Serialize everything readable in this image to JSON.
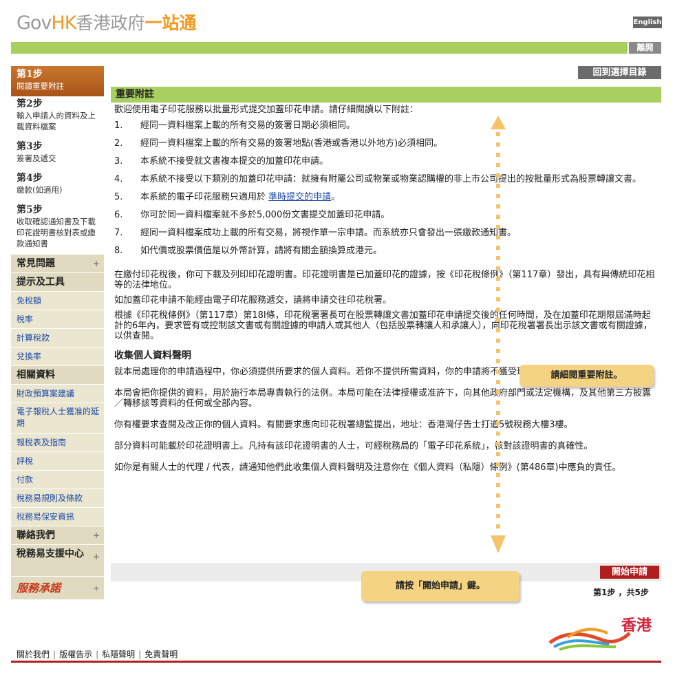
{
  "header": {
    "logo_gov": "Gov",
    "logo_hk": "HK",
    "logo_cn1": "香港政府",
    "logo_cn2": "一站通",
    "lang_button": "English",
    "leave_button": "離開"
  },
  "sidebar": {
    "steps": [
      {
        "title": "第1步",
        "desc": "閱讀重要附註"
      },
      {
        "title": "第2步",
        "desc": "輸入申請人的資料及上載資料檔案"
      },
      {
        "title": "第3步",
        "desc": "簽署及遞交"
      },
      {
        "title": "第4步",
        "desc": "繳款(如適用)"
      },
      {
        "title": "第5步",
        "desc": "收取確認通知書及下載印花證明書核對表或繳款通知書"
      }
    ],
    "faq": "常見問題",
    "tips": "提示及工具",
    "tips_items": [
      "免稅額",
      "稅率",
      "計算稅款",
      "兌換率"
    ],
    "related": "相關資料",
    "related_items": [
      "財政預算案建議",
      "電子報稅人士獲准的延期",
      "報稅表及指南",
      "評稅",
      "付款",
      "稅務易規則及條款",
      "稅務易保安資訊"
    ],
    "contact": "聯絡我們",
    "support": "稅務易支援中心",
    "signature": "服務承諾",
    "plus": "+"
  },
  "main": {
    "back_button": "回到選擇目錄",
    "section_title": "重要附註",
    "intro": "歡迎使用電子印花服務以批量形式提交加蓋印花申請。請仔細閱讀以下附註：",
    "notes": [
      {
        "num": "1.",
        "text": "經同一資料檔案上載的所有交易的簽署日期必須相同。"
      },
      {
        "num": "2.",
        "text": "經同一資料檔案上載的所有交易的簽署地點(香港或香港以外地方)必須相同。"
      },
      {
        "num": "3.",
        "text": "本系統不接受就文書複本提交的加蓋印花申請。"
      },
      {
        "num": "4.",
        "text": "本系統不接受以下類別的加蓋印花申請：就擁有附屬公司或物業或物業認購權的非上市公司提出的按批量形式為股票轉讓文書。"
      },
      {
        "num": "5.",
        "text": "本系統的電子印花服務只適用於",
        "link": "準時提交的申請",
        "tail": "。"
      },
      {
        "num": "6.",
        "text": "你可於同一資料檔案就不多於5,000份文書提交加蓋印花申請。"
      },
      {
        "num": "7.",
        "text": "經同一資料檔案成功上載的所有交易，將視作單一宗申請。而系統亦只會發出一張繳款通知書。"
      },
      {
        "num": "8.",
        "text": "如代價或股票價值是以外幣計算，請將有關金額換算成港元。"
      }
    ],
    "paras": [
      "在繳付印花稅後，你可下載及列印印花證明書。印花證明書是已加蓋印花的證據，按《印花稅條例》（第117章）發出，具有與傳統印花相等的法律地位。",
      "如加蓋印花申請不能經由電子印花服務遞交，請將申請交往印花稅署。",
      "根據《印花稅條例》（第117章）第18I條，印花稅署署長可在股票轉讓文書加蓋印花申請提交後的任何時間，及在加蓋印花期限屆滿時起計的6年內，要求管有或控制該文書或有關證據的申請人或其他人（包括股票轉讓人和承讓人），向印花稅署署長出示該文書或有關證據，以供查閱。"
    ],
    "privacy_title": "收集個人資料聲明",
    "privacy_paras": [
      "就本局處理你的申請過程中，你必須提供所要求的個人資料。若你不提供所需資料，你的申請將不獲受理。",
      "本局會把你提供的資料，用於施行本局專責執行的法例。本局可能在法律授權或准許下，向其他政府部門或法定機構，及其他第三方披露／轉移該等資料的任何或全部內容。",
      "你有權要求查閱及改正你的個人資料。有關要求應向印花稅署總監提出，地址：香港灣仔告士打道5號稅務大樓3樓。",
      "部分資料可能載於印花證明書上。凡持有該印花證明書的人士，可經稅務局的「電子印花系統」，核對該證明書的真確性。",
      "如你是有關人士的代理 / 代表，請通知他們此收集個人資料聲明及注意你在《個人資料（私隱）條例》(第486章)中應負的責任。"
    ],
    "start_button": "開始申請",
    "step_count": "第1步 ，共5步"
  },
  "callouts": {
    "read_notes": "請細閱重要附註。",
    "press_start": "請按「開始申請」鍵。"
  },
  "footer": {
    "links": [
      "關於我們",
      "版權告示",
      "私隱聲明",
      "免責聲明"
    ],
    "brand": "香港"
  },
  "colors": {
    "green_bar": "#a8cf5f",
    "active_step": "#b5601f",
    "start_button": "#b01e1e",
    "callout": "#f4d382",
    "nav_bg": "#eae6cf"
  }
}
